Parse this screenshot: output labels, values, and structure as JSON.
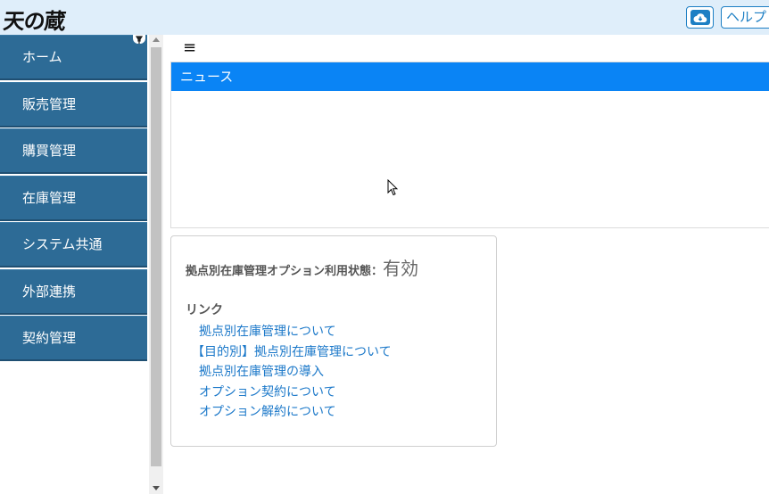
{
  "header": {
    "logo_text": "天の蔵",
    "cloud_icon": "cloud-download-icon",
    "help_label": "ヘルプ"
  },
  "sidebar": {
    "items": [
      {
        "label": "ホーム"
      },
      {
        "label": "販売管理"
      },
      {
        "label": "購買管理"
      },
      {
        "label": "在庫管理"
      },
      {
        "label": "システム共通"
      },
      {
        "label": "外部連携"
      },
      {
        "label": "契約管理"
      }
    ]
  },
  "main": {
    "hamburger": "≡",
    "news": {
      "title": "ニュース"
    },
    "info": {
      "status_label": "拠点別在庫管理オプション利用状態：",
      "status_value": "有効",
      "links_title": "リンク",
      "links": [
        "拠点別在庫管理について",
        "【目的別】拠点別在庫管理について",
        "拠点別在庫管理の導入",
        "オプション契約について",
        "オプション解約について"
      ]
    }
  },
  "colors": {
    "topbar": "#dfeefa",
    "sidebar_item": "#2d6b96",
    "news_header": "#0a84f5",
    "link": "#1b78c9"
  }
}
